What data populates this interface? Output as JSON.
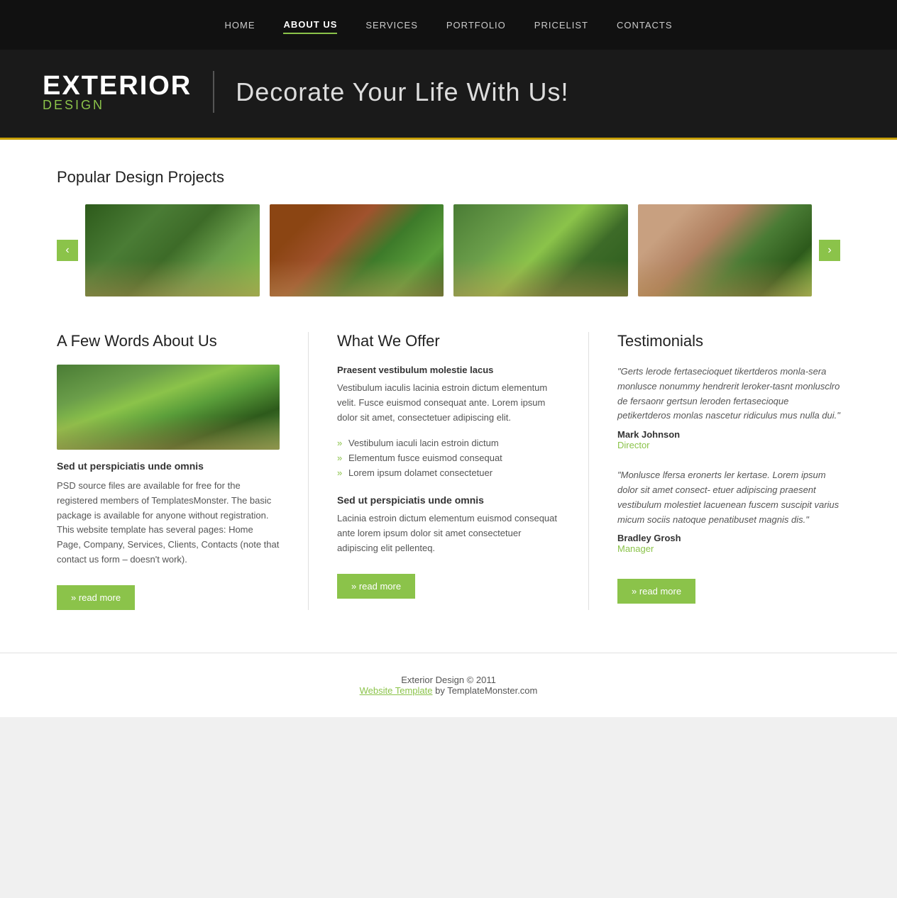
{
  "nav": {
    "items": [
      {
        "label": "HOME",
        "active": false
      },
      {
        "label": "ABOUT US",
        "active": true
      },
      {
        "label": "SERVICES",
        "active": false
      },
      {
        "label": "PORTFOLIO",
        "active": false
      },
      {
        "label": "PRICELIST",
        "active": false
      },
      {
        "label": "CONTACTS",
        "active": false
      }
    ]
  },
  "hero": {
    "brand_main": "EXTERIOR",
    "brand_sub": "DESIGN",
    "tagline": "Decorate Your Life With Us!"
  },
  "projects": {
    "title": "Popular Design Projects"
  },
  "about": {
    "title": "A Few Words About Us",
    "subtitle": "Sed ut perspiciatis unde omnis",
    "text": "PSD source files are available for free for the registered members of TemplatesMonster. The basic package is available for anyone without registration. This website template has several pages: Home Page, Company, Services, Clients, Contacts (note that contact us form – doesn't work).",
    "read_more": "» read more"
  },
  "offer": {
    "title": "What We Offer",
    "headline1": "Praesent vestibulum molestie lacus",
    "body1": "Vestibulum iaculis lacinia estroin dictum elementum velit. Fusce euismod consequat ante. Lorem ipsum dolor sit amet, consectetuer adipiscing elit.",
    "list": [
      "Vestibulum iaculi lacin estroin dictum",
      "Elementum fusce euismod consequat",
      "Lorem ipsum dolamet consectetuer"
    ],
    "headline2": "Sed ut perspiciatis unde omnis",
    "body2": "Lacinia estroin dictum elementum euismod consequat ante lorem ipsum dolor sit amet consectetuer adipiscing elit pellenteq.",
    "read_more": "» read more"
  },
  "testimonials": {
    "title": "Testimonials",
    "items": [
      {
        "text": "\"Gerts lerode fertasecioquet tikertderos monla-sera monlusce nonummy hendrerit leroker-tasnt monlusclro de fersaonr gertsun leroden fertasecioque petikertderos monlas nascetur ridiculus mus nulla dui.\"",
        "name": "Mark Johnson",
        "role": "Director"
      },
      {
        "text": "\"Monlusce lfersa eronerts ler kertase. Lorem ipsum dolor sit amet consect- etuer adipiscing praesent vestibulum molestiet lacuenean fuscem suscipit varius micum sociis natoque penatibuset magnis dis.\"",
        "name": "Bradley Grosh",
        "role": "Manager"
      }
    ],
    "read_more": "» read more"
  },
  "footer": {
    "copyright": "Exterior Design © 2011",
    "link_text": "Website Template",
    "suffix": " by TemplateMonster.com"
  }
}
